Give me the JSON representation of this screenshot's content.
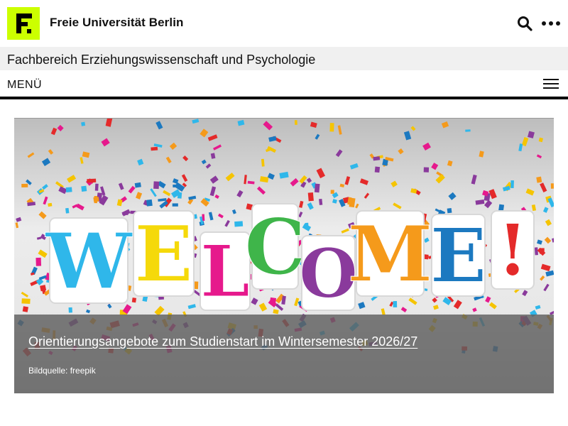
{
  "header": {
    "university_name": "Freie Universität Berlin",
    "logo_color": "#ccff00",
    "icons": [
      "search-icon",
      "more-icon"
    ]
  },
  "department": {
    "title": "Fachbereich Erziehungswissenschaft und Psychologie"
  },
  "menu": {
    "label": "MENÜ",
    "icon": "hamburger-icon"
  },
  "hero": {
    "image_text": "WELCOME!",
    "title": "Orientierungsangebote zum Studienstart im Wintersemester 2026/27",
    "credit": "Bildquelle: freepik",
    "letters": [
      {
        "char": "W",
        "color": "#2fb7ea"
      },
      {
        "char": "E",
        "color": "#f5d90a"
      },
      {
        "char": "L",
        "color": "#e6198c"
      },
      {
        "char": "C",
        "color": "#3fb54a"
      },
      {
        "char": "O",
        "color": "#8a3a9c"
      },
      {
        "char": "M",
        "color": "#f59a1b"
      },
      {
        "char": "E",
        "color": "#1c79c0"
      },
      {
        "char": "!",
        "color": "#e42a2a"
      }
    ]
  }
}
